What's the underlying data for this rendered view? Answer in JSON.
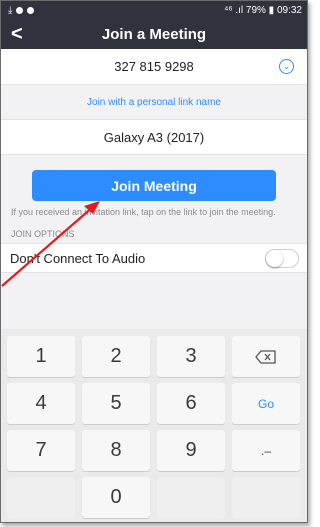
{
  "status_bar": {
    "left_icon": "download-arrow-icon",
    "right_text": "⁴⁶ .ıl 79% ▮ 09:32",
    "colors": {
      "bar": "#30323e"
    }
  },
  "header": {
    "back": "<",
    "title": "Join a Meeting"
  },
  "meeting_id": "327 815 9298",
  "personal_link": "Join with a personal link name",
  "display_name": "Galaxy A3 (2017)",
  "join_button": "Join Meeting",
  "hint_text": "If you received an invitation link, tap on the link to join the meeting.",
  "join_options_label": "JOIN OPTIONS",
  "audio_option": {
    "label": "Don't Connect To Audio",
    "enabled": false
  },
  "keypad": {
    "row1": [
      "1",
      "2",
      "3",
      "⌫"
    ],
    "row2": [
      "4",
      "5",
      "6",
      "Go"
    ],
    "row3": [
      "7",
      "8",
      "9",
      ".–"
    ],
    "row4": [
      "",
      "0",
      "",
      ""
    ]
  },
  "colors": {
    "accent": "#2d8cff",
    "annotation_arrow": "#e21b1b"
  }
}
